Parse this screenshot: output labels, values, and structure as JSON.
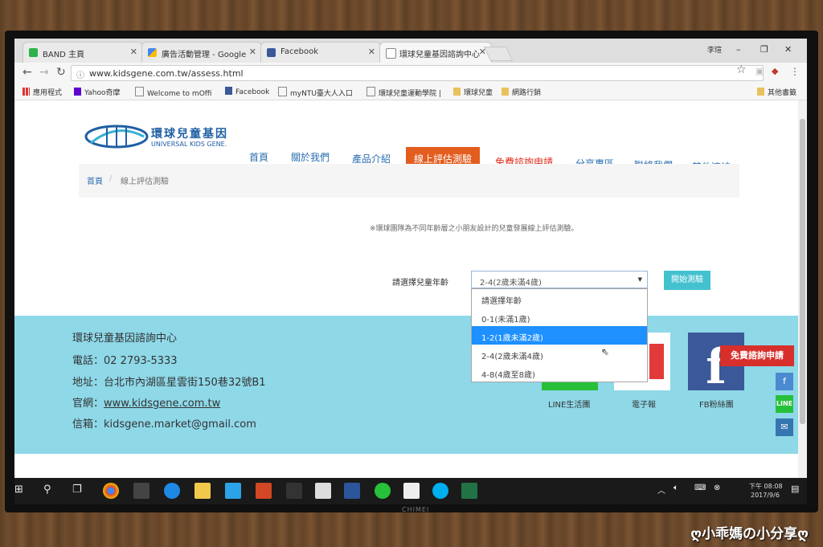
{
  "browser": {
    "tabs": [
      {
        "label": "BAND 主頁",
        "icon": "band-icon"
      },
      {
        "label": "廣告活動管理 - Google",
        "icon": "google-ads-icon"
      },
      {
        "label": "Facebook",
        "icon": "facebook-icon"
      },
      {
        "label": "環球兒童基因諮詢中心",
        "icon": "page-icon"
      }
    ],
    "user": "李瑄",
    "url": "www.kidsgene.com.tw/assess.html",
    "bookmarks": [
      "應用程式",
      "Yahoo奇摩",
      "Welcome to mOffi",
      "Facebook",
      "myNTU臺大人入口",
      "環球兒童運動學院 |",
      "環球兒童",
      "網路行銷"
    ],
    "other_bookmarks": "其他書籤"
  },
  "site": {
    "logo_zh": "環球兒童基因",
    "logo_en": "UNIVERSAL KIDS GENE.",
    "nav": [
      "首頁",
      "關於我們",
      "產品介紹",
      "線上評估測驗",
      "免費諮詢申請",
      "分享專區",
      "聯絡我們",
      "其他連結"
    ],
    "breadcrumb": {
      "home": "首頁",
      "sep": "/",
      "current": "線上評估測驗"
    },
    "note": "※環球團隊為不同年齡層之小朋友設計的兒童發展線上評估測驗。",
    "select_label": "請選擇兒童年齡",
    "select_value": "2-4(2歲未滿4歲)",
    "options": [
      "請選擇年齡",
      "0-1(未滿1歲)",
      "1-2(1歲未滿2歲)",
      "2-4(2歲未滿4歲)",
      "4-8(4歲至8歲)"
    ],
    "start_button": "開始測驗"
  },
  "footer": {
    "name": "環球兒童基因諮詢中心",
    "phone": "電話：02 2793-5333",
    "address": "地址：台北市內湖區星雲街150巷32號B1",
    "website_label": "官網：",
    "website": "www.kidsgene.com.tw",
    "email": "信箱：kidsgene.market@gmail.com",
    "line_label": "LINE生活團",
    "epaper_label": "電子報",
    "fb_label": "FB粉絲團",
    "free_consult": "免費諮詢申請"
  },
  "taskbar": {
    "time": "下午 08:08",
    "date": "2017/9/6"
  },
  "monitor_brand": "CHIMEI",
  "watermark": "ღ小乖媽の小分享ღ",
  "colors": {
    "accent_orange": "#e35d1f",
    "link_blue": "#2a6db0",
    "footer_bg": "#8ed8e8",
    "start_teal": "#43c1cf",
    "highlight": "#1e90ff"
  }
}
